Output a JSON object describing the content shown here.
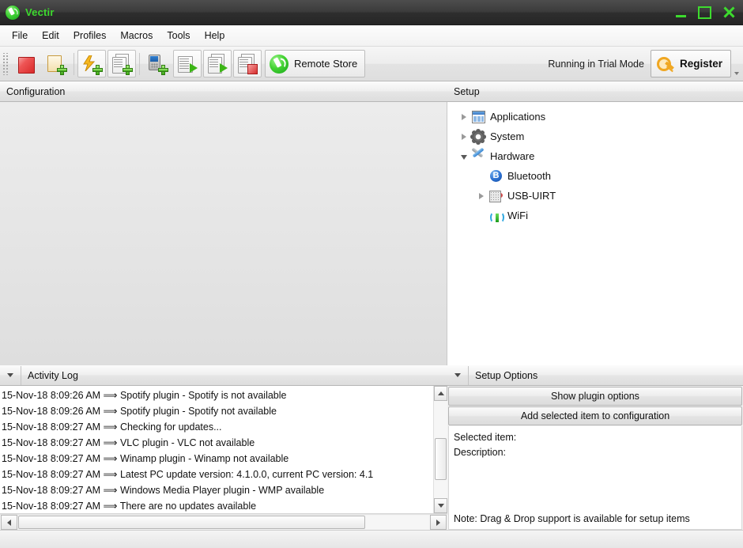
{
  "window": {
    "title": "Vectir",
    "icon": "vectir-logo-icon",
    "minimize": "–",
    "maximize": "□",
    "close": "×",
    "accent_green": "#3ddb2e",
    "titlebar_color": "#333333"
  },
  "menubar": {
    "items": [
      {
        "label": "File"
      },
      {
        "label": "Edit"
      },
      {
        "label": "Profiles"
      },
      {
        "label": "Macros"
      },
      {
        "label": "Tools"
      },
      {
        "label": "Help"
      }
    ]
  },
  "toolbar": {
    "buttons": [
      {
        "name": "stop-button",
        "icon": "red-square-stop-icon"
      },
      {
        "name": "new-profile-button",
        "icon": "folder-add-icon"
      },
      {
        "name": "add-event-button",
        "icon": "lightning-add-icon"
      },
      {
        "name": "add-macro-button",
        "icon": "pages-add-icon"
      },
      {
        "name": "add-device-button",
        "icon": "phone-add-icon"
      },
      {
        "name": "run-macro-button",
        "icon": "page-play-icon"
      },
      {
        "name": "run-all-macros-button",
        "icon": "pages-play-icon"
      },
      {
        "name": "stop-macro-button",
        "icon": "pages-stop-icon"
      }
    ],
    "remote_store": {
      "label": "Remote Store",
      "icon": "vectir-logo-icon"
    },
    "trial_text": "Running in Trial Mode",
    "register": {
      "label": "Register",
      "icon": "key-icon"
    },
    "overflow_icon": "chevron-down-icon"
  },
  "configuration_panel": {
    "title": "Configuration",
    "items": []
  },
  "setup_panel": {
    "title": "Setup",
    "tree": [
      {
        "label": "Applications",
        "icon": "applications-icon",
        "expander": "collapsed",
        "depth": 0
      },
      {
        "label": "System",
        "icon": "gear-icon",
        "expander": "collapsed",
        "depth": 0
      },
      {
        "label": "Hardware",
        "icon": "tools-icon",
        "expander": "expanded",
        "depth": 0
      },
      {
        "label": "Bluetooth",
        "icon": "bluetooth-icon",
        "expander": "none",
        "depth": 1
      },
      {
        "label": "USB-UIRT",
        "icon": "usb-uirt-icon",
        "expander": "collapsed",
        "depth": 1
      },
      {
        "label": "WiFi",
        "icon": "wifi-icon",
        "expander": "none",
        "depth": 1
      }
    ]
  },
  "activity_log": {
    "title": "Activity Log",
    "toggle_icon": "chevron-down-icon",
    "lines": [
      "15-Nov-18 8:09:26 AM ⟹ Spotify plugin - Spotify is not available",
      "15-Nov-18 8:09:26 AM ⟹ Spotify plugin - Spotify not available",
      "15-Nov-18 8:09:27 AM ⟹ Checking for updates...",
      "15-Nov-18 8:09:27 AM ⟹ VLC plugin - VLC not available",
      "15-Nov-18 8:09:27 AM ⟹ Winamp plugin - Winamp not available",
      "15-Nov-18 8:09:27 AM ⟹ Latest PC update version: 4.1.0.0, current PC version: 4.1",
      "15-Nov-18 8:09:27 AM ⟹ Windows Media Player plugin - WMP available",
      "15-Nov-18 8:09:27 AM ⟹ There are no updates available"
    ],
    "scroll_up_icon": "triangle-up-icon",
    "scroll_down_icon": "triangle-down-icon",
    "scroll_left_icon": "triangle-left-icon",
    "scroll_right_icon": "triangle-right-icon"
  },
  "setup_options": {
    "title": "Setup Options",
    "toggle_icon": "chevron-down-icon",
    "show_plugin_options_label": "Show plugin options",
    "add_selected_item_label": "Add selected item to configuration",
    "selected_item_label": "Selected item:",
    "description_label": "Description:",
    "note": "Note: Drag & Drop support is available for setup items"
  }
}
